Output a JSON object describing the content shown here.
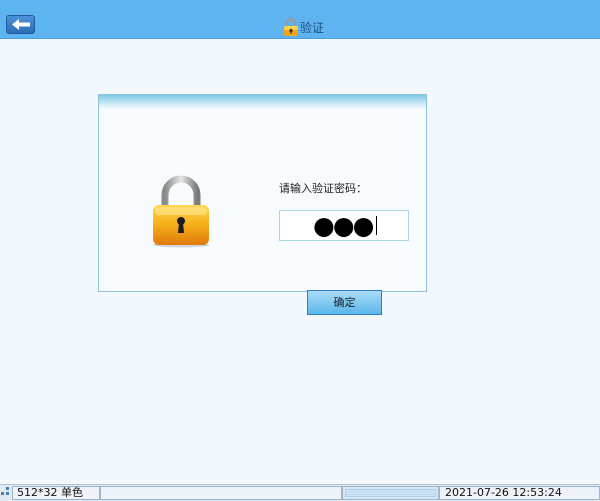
{
  "header": {
    "title": "验证",
    "back_icon": "back-arrow-icon",
    "title_icon": "lock-icon"
  },
  "dialog": {
    "prompt": "请输入验证密码：",
    "password_display": "●●●",
    "lock_icon": "lock-icon",
    "ok_label": "确定"
  },
  "statusbar": {
    "mode": "512*32 单色",
    "datetime": "2021-07-26 12:53:24"
  },
  "colors": {
    "titlebar": "#5db4f0",
    "background": "#f3f8fc",
    "panel_border": "#8cc3d6"
  }
}
